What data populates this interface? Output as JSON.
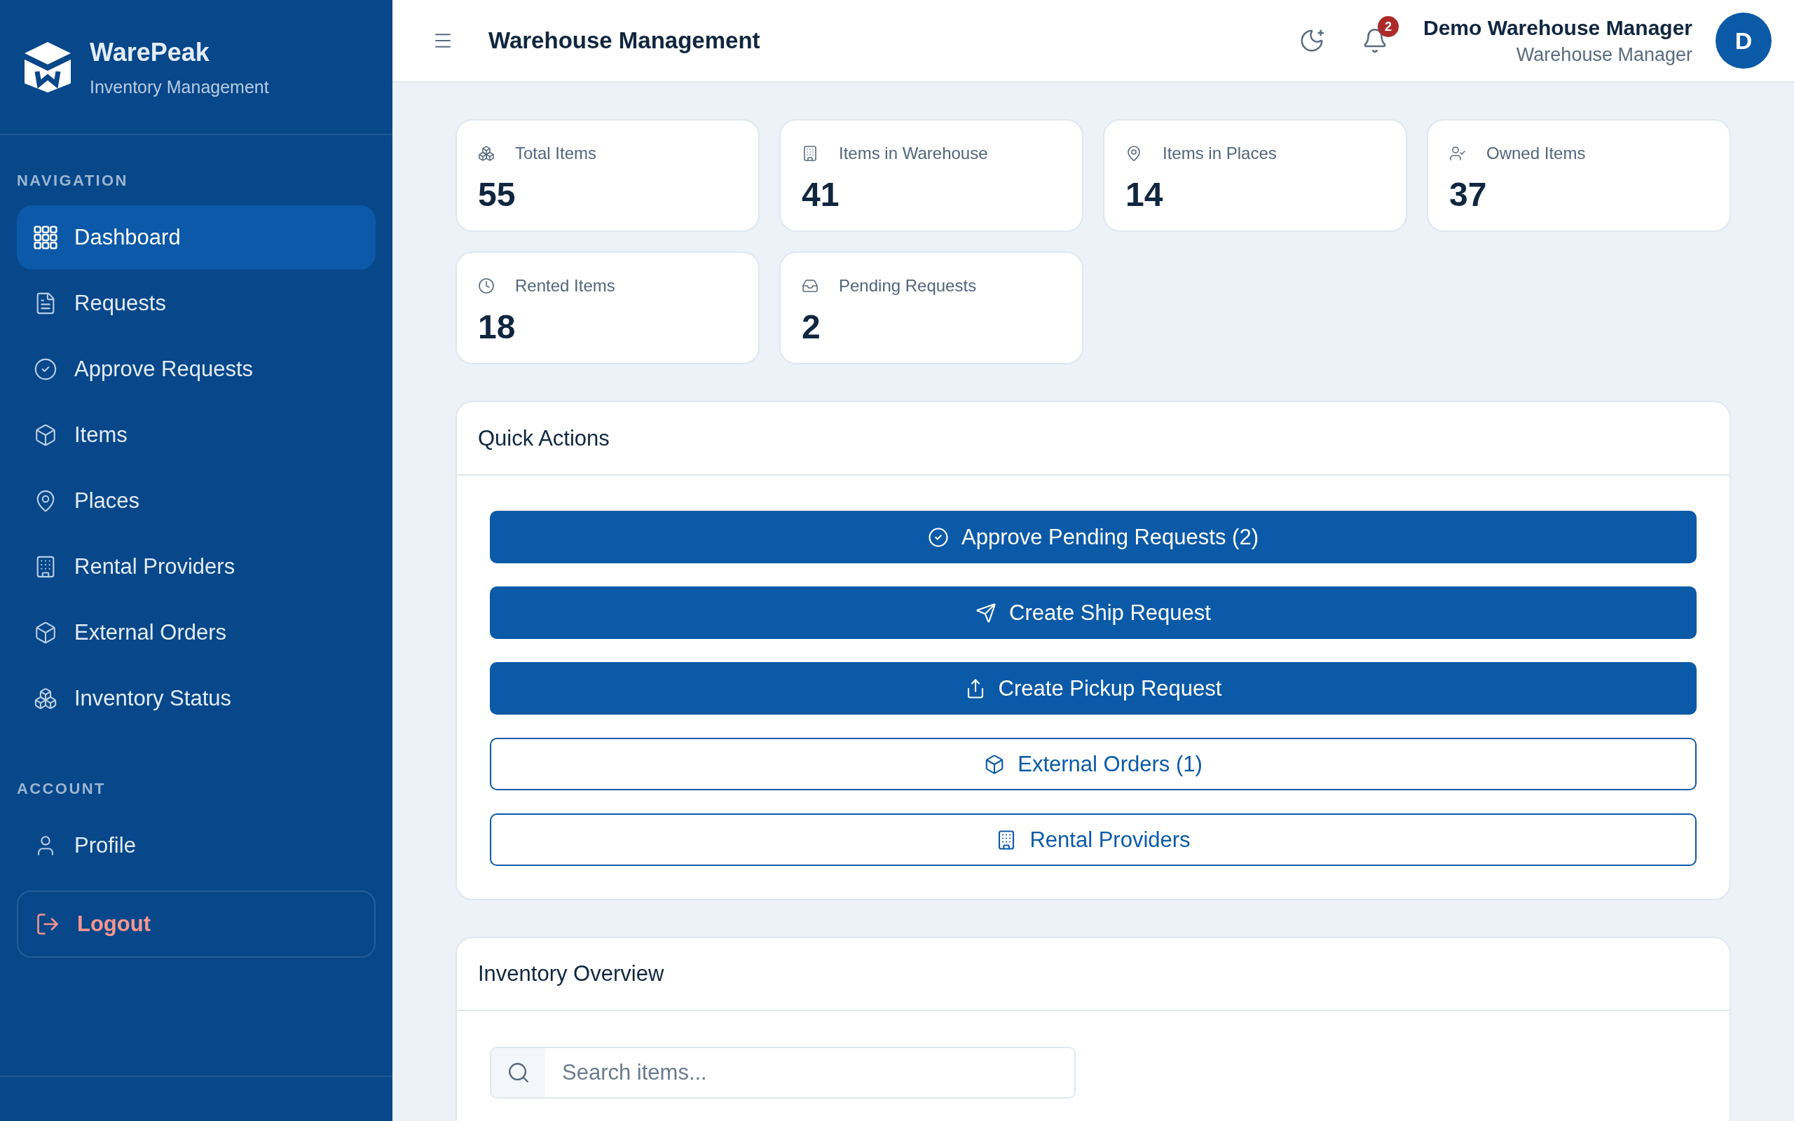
{
  "sidebar": {
    "brand": {
      "name": "WarePeak",
      "subtitle": "Inventory Management"
    },
    "sections": [
      {
        "title": "NAVIGATION",
        "items": [
          {
            "label": "Dashboard",
            "selected": true
          },
          {
            "label": "Requests",
            "selected": false
          },
          {
            "label": "Approve Requests",
            "selected": false
          },
          {
            "label": "Items",
            "selected": false
          },
          {
            "label": "Places",
            "selected": false
          },
          {
            "label": "Rental Providers",
            "selected": false
          },
          {
            "label": "External Orders",
            "selected": false
          },
          {
            "label": "Inventory Status",
            "selected": false
          }
        ]
      },
      {
        "title": "ACCOUNT",
        "items": [
          {
            "label": "Profile",
            "selected": false
          }
        ]
      }
    ],
    "logout": {
      "label": "Logout"
    }
  },
  "header": {
    "title": "Warehouse Management",
    "notification_count": "2",
    "user": {
      "name": "Demo Warehouse Manager",
      "role": "Warehouse Manager",
      "initial": "D"
    }
  },
  "stats": [
    {
      "label": "Total Items",
      "value": "55"
    },
    {
      "label": "Items in Warehouse",
      "value": "41"
    },
    {
      "label": "Items in Places",
      "value": "14"
    },
    {
      "label": "Owned Items",
      "value": "37"
    },
    {
      "label": "Rented Items",
      "value": "18"
    },
    {
      "label": "Pending Requests",
      "value": "2"
    }
  ],
  "quick_actions": {
    "title": "Quick Actions",
    "buttons": [
      {
        "label": "Approve Pending Requests (2)",
        "kind": "primary"
      },
      {
        "label": "Create Ship Request",
        "kind": "primary"
      },
      {
        "label": "Create Pickup Request",
        "kind": "primary"
      },
      {
        "label": "External Orders (1)",
        "kind": "outline"
      },
      {
        "label": "Rental Providers",
        "kind": "outline"
      }
    ]
  },
  "inventory_overview": {
    "title": "Inventory Overview",
    "search": {
      "placeholder": "Search items..."
    }
  }
}
